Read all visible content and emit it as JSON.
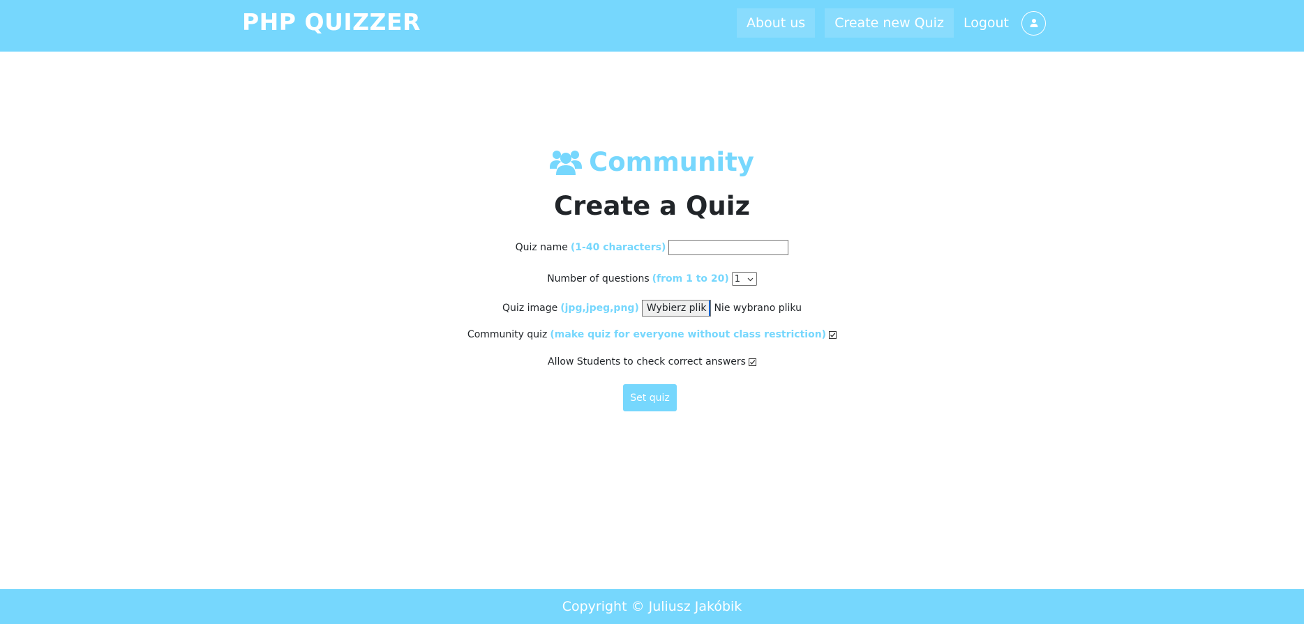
{
  "header": {
    "brand": "PHP QUIZZER",
    "nav": {
      "about_label": "About us",
      "create_label": "Create new Quiz",
      "logout_label": "Logout",
      "avatar_icon": "user-icon"
    }
  },
  "main": {
    "section_label": "Community",
    "section_icon": "users-icon",
    "title": "Create a Quiz",
    "form": {
      "quiz_name": {
        "label": "Quiz name",
        "hint": "(1-40 characters)",
        "value": ""
      },
      "num_questions": {
        "label": "Number of questions",
        "hint": "(from 1 to 20)",
        "selected": "1"
      },
      "quiz_image": {
        "label": "Quiz image",
        "hint": "(jpg,jpeg,png)",
        "button_label": "Wybierz plik",
        "status": "Nie wybrano pliku"
      },
      "community_quiz": {
        "label": "Community quiz",
        "hint": "(make quiz for everyone without class restriction)",
        "checked": true
      },
      "allow_check": {
        "label": "Allow Students to check correct answers",
        "checked": true
      },
      "submit_label": "Set quiz"
    }
  },
  "footer": {
    "copyright": "Copyright © Juliusz Jakóbik"
  },
  "colors": {
    "accent": "#76d7fd",
    "text": "#212529",
    "white": "#ffffff"
  }
}
